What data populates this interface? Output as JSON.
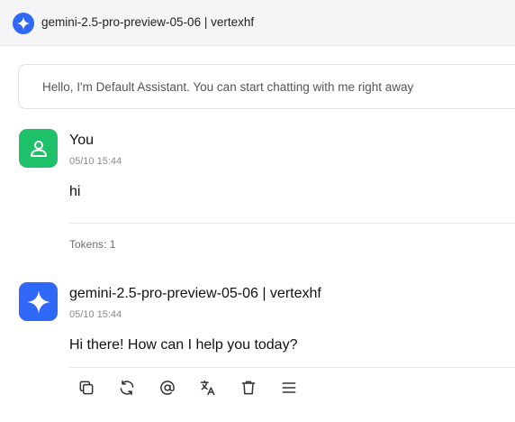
{
  "header": {
    "title": "gemini-2.5-pro-preview-05-06 | vertexhf",
    "logo_icon": "sparkle-icon",
    "logo_color": "#2f67f6"
  },
  "greeting": {
    "text": "Hello, I'm Default Assistant. You can start chatting with me right away"
  },
  "messages": [
    {
      "role": "user",
      "sender": "You",
      "time": "05/10 15:44",
      "content": "hi",
      "tokens": "Tokens: 1",
      "avatar_icon": "user-icon",
      "avatar_color": "#1fc06a"
    },
    {
      "role": "assistant",
      "sender": "gemini-2.5-pro-preview-05-06 | vertexhf",
      "time": "05/10 15:44",
      "content": "Hi there! How can I help you today?",
      "avatar_icon": "sparkle-icon",
      "avatar_color": "#2f67f6"
    }
  ],
  "toolbar": {
    "actions": [
      "copy-icon",
      "regenerate-icon",
      "mention-icon",
      "translate-icon",
      "delete-icon",
      "more-menu-icon"
    ]
  }
}
